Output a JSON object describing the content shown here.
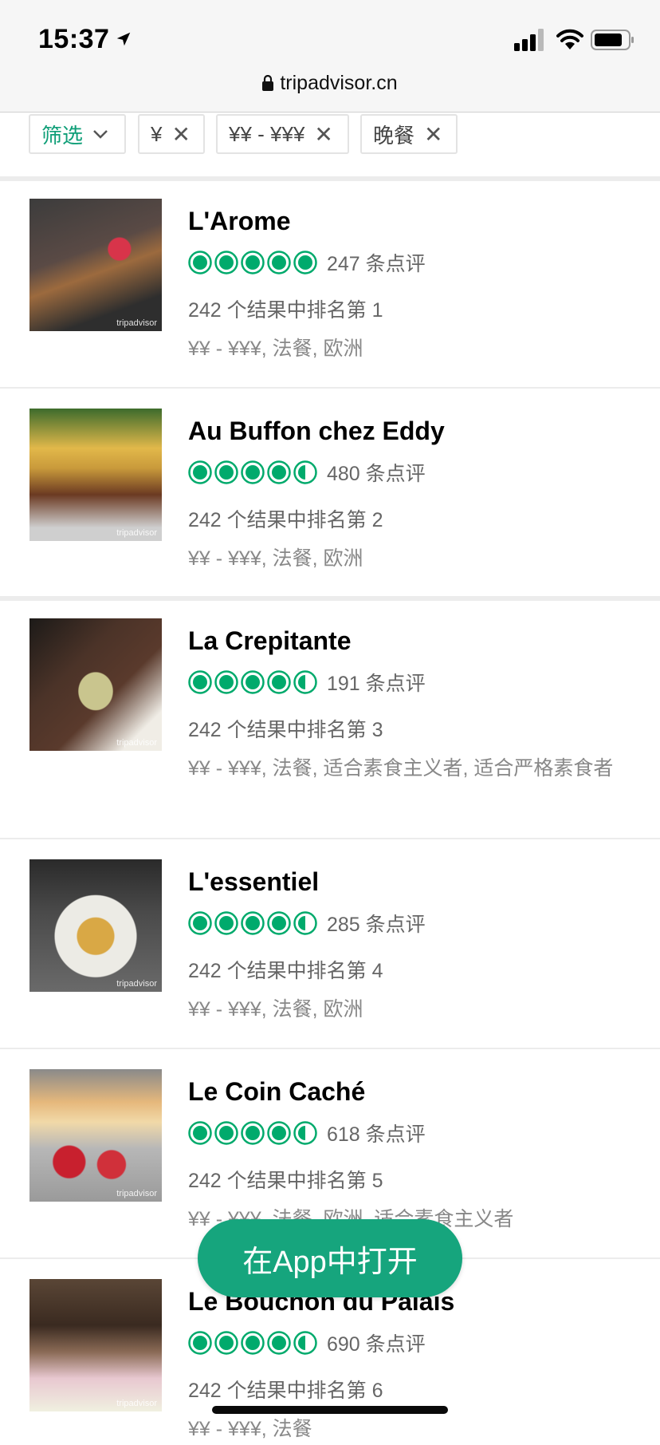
{
  "status_bar": {
    "time": "15:37",
    "icons": [
      "location-arrow-icon",
      "signal-icon",
      "wifi-icon",
      "battery-icon"
    ]
  },
  "url_bar": {
    "url": "tripadvisor.cn",
    "icon": "lock-icon"
  },
  "filters": {
    "filter_label": "筛选",
    "chips": [
      "¥",
      "¥¥ - ¥¥¥",
      "晚餐"
    ]
  },
  "colors": {
    "accent": "#0e9e77",
    "bubble": "#00aa6c",
    "button": "#16a57d"
  },
  "restaurants": [
    {
      "name": "L'Arome",
      "rating": 5,
      "reviews": "247 条点评",
      "rank": "242 个结果中排名第 1",
      "cuisine": "¥¥ - ¥¥¥, 法餐, 欧洲",
      "watermark": "tripadvisor"
    },
    {
      "name": "Au Buffon chez Eddy",
      "rating": 4.5,
      "reviews": "480 条点评",
      "rank": "242 个结果中排名第 2",
      "cuisine": "¥¥ - ¥¥¥, 法餐, 欧洲",
      "watermark": "tripadvisor"
    },
    {
      "name": "La Crepitante",
      "rating": 4.5,
      "reviews": "191 条点评",
      "rank": "242 个结果中排名第 3",
      "cuisine": "¥¥ - ¥¥¥, 法餐, 适合素食主义者, 适合严格素食者",
      "watermark": "tripadvisor"
    },
    {
      "name": "L'essentiel",
      "rating": 4.5,
      "reviews": "285 条点评",
      "rank": "242 个结果中排名第 4",
      "cuisine": "¥¥ - ¥¥¥, 法餐, 欧洲",
      "watermark": "tripadvisor"
    },
    {
      "name": "Le Coin Caché",
      "rating": 4.5,
      "reviews": "618 条点评",
      "rank": "242 个结果中排名第 5",
      "cuisine": "¥¥ - ¥¥¥, 法餐, 欧洲, 适合素食主义者",
      "watermark": "tripadvisor"
    },
    {
      "name": "Le Bouchon du Palais",
      "rating": 4.5,
      "reviews": "690 条点评",
      "rank": "242 个结果中排名第 6",
      "cuisine": "¥¥ - ¥¥¥, 法餐",
      "watermark": "tripadvisor"
    }
  ],
  "open_app_label": "在App中打开"
}
